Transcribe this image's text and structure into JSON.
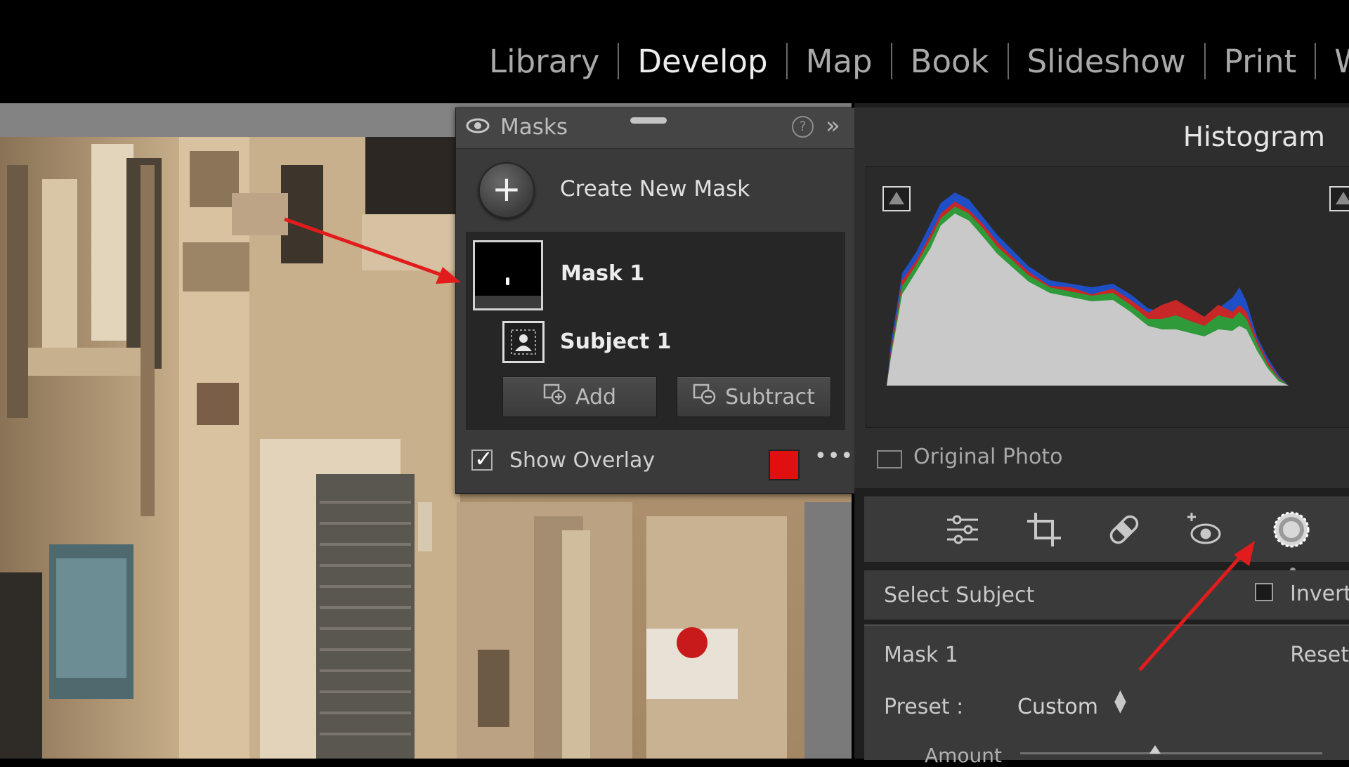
{
  "modules": [
    {
      "label": "Library",
      "active": false
    },
    {
      "label": "Develop",
      "active": true
    },
    {
      "label": "Map",
      "active": false
    },
    {
      "label": "Book",
      "active": false
    },
    {
      "label": "Slideshow",
      "active": false
    },
    {
      "label": "Print",
      "active": false
    },
    {
      "label": "Web",
      "active": false
    }
  ],
  "masks_panel": {
    "title": "Masks",
    "help_icon": "?",
    "collapse_icon": "»",
    "create_new_mask": "Create New Mask",
    "mask_name": "Mask 1",
    "component_name": "Subject 1",
    "add_label": "Add",
    "subtract_label": "Subtract",
    "show_overlay_label": "Show Overlay",
    "show_overlay_checked": true,
    "overlay_color": "#e01010",
    "more_icon": "•••"
  },
  "histogram": {
    "title": "Histogram",
    "original_photo_label": "Original Photo",
    "original_photo_checked": false
  },
  "tools": [
    "edit-sliders-icon",
    "crop-icon",
    "healing-icon",
    "red-eye-icon",
    "masking-icon"
  ],
  "mask_tool": {
    "select_subject_label": "Select Subject",
    "invert_label": "Invert",
    "invert_checked": false,
    "mask_name": "Mask 1",
    "reset_label": "Reset",
    "preset_label": "Preset :",
    "preset_value": "Custom",
    "amount_label": "Amount"
  },
  "colors": {
    "accent_red": "#e01010",
    "background": "#000000",
    "panel": "#3a3a3a"
  }
}
